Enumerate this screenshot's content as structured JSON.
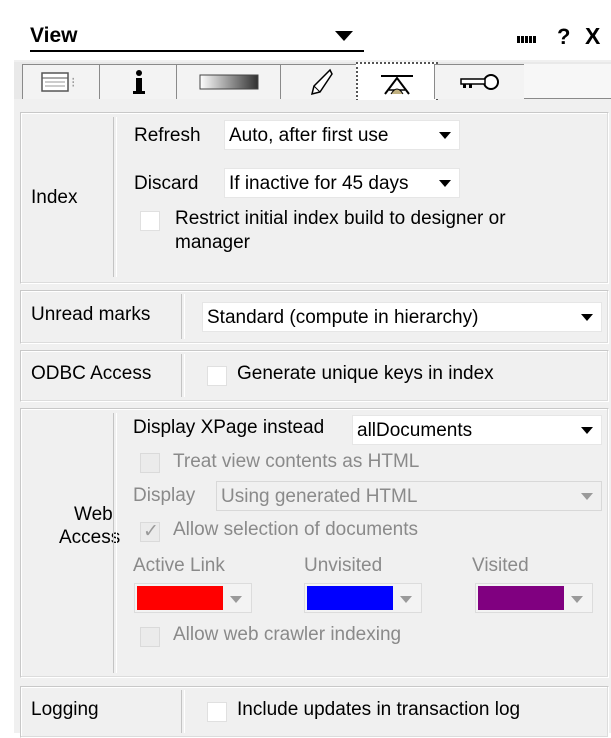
{
  "titlebar": {
    "title": "View",
    "help_label": "?",
    "close_label": "X"
  },
  "tabs": [
    {
      "icon": "info-table-icon"
    },
    {
      "icon": "info-i-icon",
      "label": "i"
    },
    {
      "icon": "gradient-icon"
    },
    {
      "icon": "rocket-icon"
    },
    {
      "icon": "advanced-icon",
      "active": true
    },
    {
      "icon": "key-icon"
    }
  ],
  "index": {
    "label": "Index",
    "refresh_label": "Refresh",
    "refresh_value": "Auto, after first use",
    "discard_label": "Discard",
    "discard_value": "If inactive for 45 days",
    "restrict_label": "Restrict initial index build to designer or",
    "restrict_label2": "manager",
    "restrict_checked": false
  },
  "unread": {
    "label": "Unread marks",
    "value": "Standard (compute in hierarchy)"
  },
  "odbc": {
    "label": "ODBC Access",
    "unique_keys_label": "Generate unique keys in index",
    "unique_keys_checked": false
  },
  "web": {
    "label1": "Web",
    "label2": "Access",
    "xpage_label": "Display XPage instead",
    "xpage_value": "allDocuments",
    "treat_html_label": "Treat view contents as HTML",
    "display_label": "Display",
    "display_value": "Using generated HTML",
    "allow_selection_label": "Allow selection of documents",
    "allow_selection_mark": "✓",
    "active_link_label": "Active Link",
    "unvisited_label": "Unvisited",
    "visited_label": "Visited",
    "active_link_color": "#ff0000",
    "unvisited_color": "#0000ff",
    "visited_color": "#800080",
    "crawler_label": "Allow web crawler indexing"
  },
  "logging": {
    "label": "Logging",
    "include_label": "Include updates in transaction log",
    "include_checked": false
  }
}
